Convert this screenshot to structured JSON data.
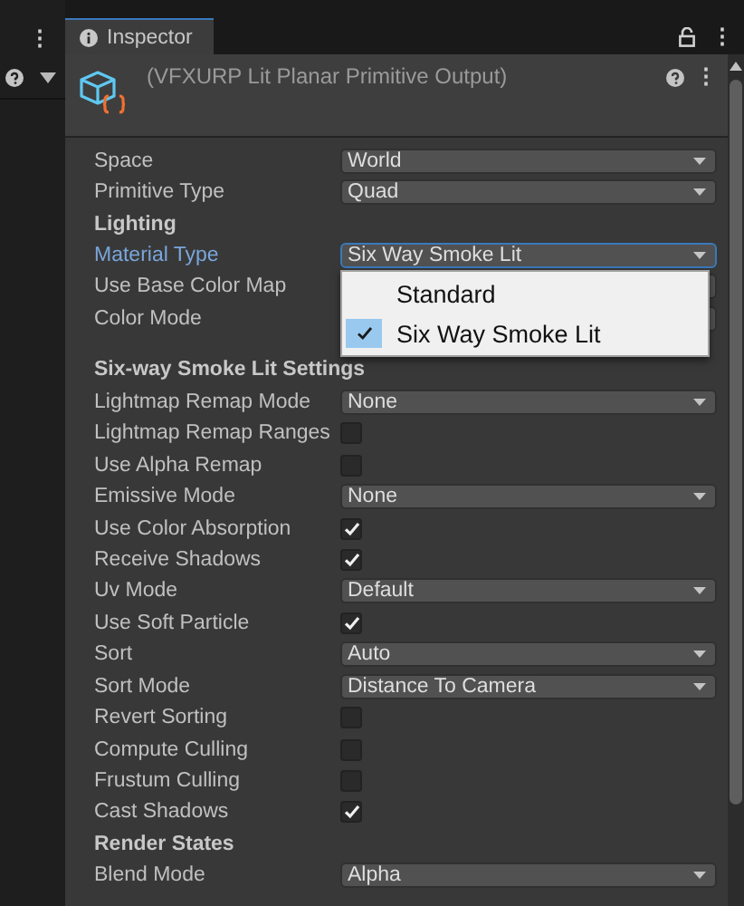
{
  "left_panel": {
    "menu_glyph": "⋮"
  },
  "tab": {
    "label": "Inspector",
    "selected": true
  },
  "tab_menu_glyph": "⋮",
  "header": {
    "title": "(VFXURP Lit Planar Primitive Output)",
    "menu_glyph": "⋮"
  },
  "rows": [
    {
      "kind": "dropdown",
      "label": "Space",
      "value": "World",
      "focused": false
    },
    {
      "kind": "dropdown",
      "label": "Primitive Type",
      "value": "Quad",
      "focused": false
    },
    {
      "kind": "header",
      "label": "Lighting"
    },
    {
      "kind": "dropdown",
      "label": "Material Type",
      "value": "Six Way Smoke Lit",
      "focused": true
    },
    {
      "kind": "dropdown",
      "label": "Use Base Color Map",
      "focused": false
    },
    {
      "kind": "dropdown",
      "label": "Color Mode",
      "focused": false
    },
    {
      "kind": "spacer"
    },
    {
      "kind": "header",
      "label": "Six-way Smoke Lit Settings"
    },
    {
      "kind": "dropdown",
      "label": "Lightmap Remap Mode",
      "value": "None",
      "focused": false
    },
    {
      "kind": "checkbox",
      "label": "Lightmap Remap Ranges",
      "checked": false
    },
    {
      "kind": "checkbox",
      "label": "Use Alpha Remap",
      "checked": false
    },
    {
      "kind": "dropdown",
      "label": "Emissive Mode",
      "value": "None",
      "focused": false
    },
    {
      "kind": "checkbox",
      "label": "Use Color Absorption",
      "checked": true
    },
    {
      "kind": "checkbox",
      "label": "Receive Shadows",
      "checked": true
    },
    {
      "kind": "dropdown",
      "label": "Uv Mode",
      "value": "Default",
      "focused": false
    },
    {
      "kind": "checkbox",
      "label": "Use Soft Particle",
      "checked": true
    },
    {
      "kind": "dropdown",
      "label": "Sort",
      "value": "Auto",
      "focused": false
    },
    {
      "kind": "dropdown",
      "label": "Sort Mode",
      "value": "Distance To Camera",
      "focused": false
    },
    {
      "kind": "checkbox",
      "label": "Revert Sorting",
      "checked": false
    },
    {
      "kind": "checkbox",
      "label": "Compute Culling",
      "checked": false
    },
    {
      "kind": "checkbox",
      "label": "Frustum Culling",
      "checked": false
    },
    {
      "kind": "checkbox",
      "label": "Cast Shadows",
      "checked": true
    },
    {
      "kind": "header",
      "label": "Render States"
    },
    {
      "kind": "dropdown",
      "label": "Blend Mode",
      "value": "Alpha",
      "focused": false
    }
  ],
  "popup": {
    "options": [
      {
        "label": "Standard",
        "selected": false
      },
      {
        "label": "Six Way Smoke Lit",
        "selected": true
      }
    ]
  }
}
